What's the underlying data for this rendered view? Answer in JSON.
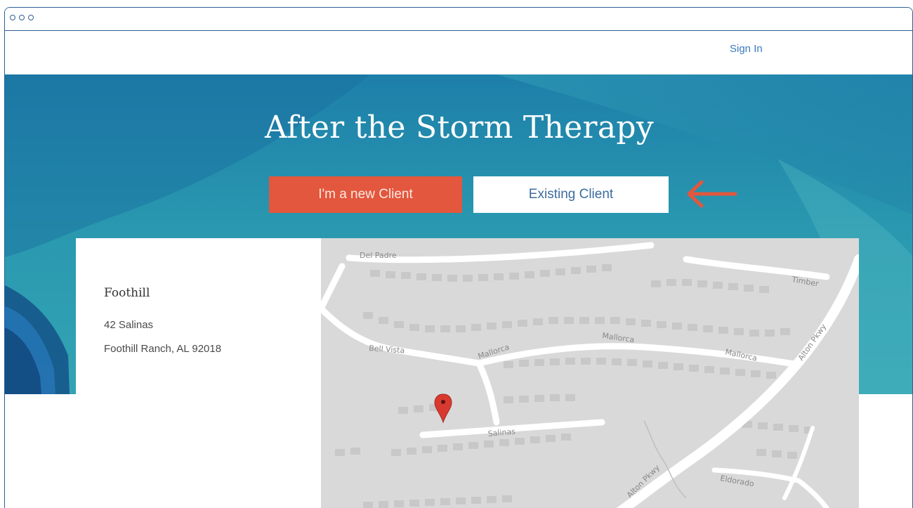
{
  "nav": {
    "sign_in": "Sign In"
  },
  "hero": {
    "title": "After the Storm Therapy"
  },
  "buttons": {
    "new_client": "I'm a new Client",
    "existing_client": "Existing Client"
  },
  "location": {
    "name": "Foothill",
    "address_line1": "42 Salinas",
    "address_line2": "Foothill Ranch, AL 92018"
  },
  "map": {
    "streets": {
      "del_padre": "Del Padre",
      "timber": "Timber",
      "bell_vista": "Bell Vista",
      "mallorca_1": "Mallorca",
      "mallorca_2": "Mallorca",
      "mallorca_3": "Mallorca",
      "alton_top": "Alton Pkwy",
      "alton_bottom": "Alton Pkwy",
      "salinas": "Salinas",
      "dorado": "Eldorado"
    }
  },
  "colors": {
    "primary": "#e2573d",
    "link": "#3a7ac0",
    "hero": "#2a99b0",
    "frame": "#2f5f96"
  },
  "icons": {
    "arrow": "arrow-left-icon",
    "pin": "map-pin-icon"
  }
}
